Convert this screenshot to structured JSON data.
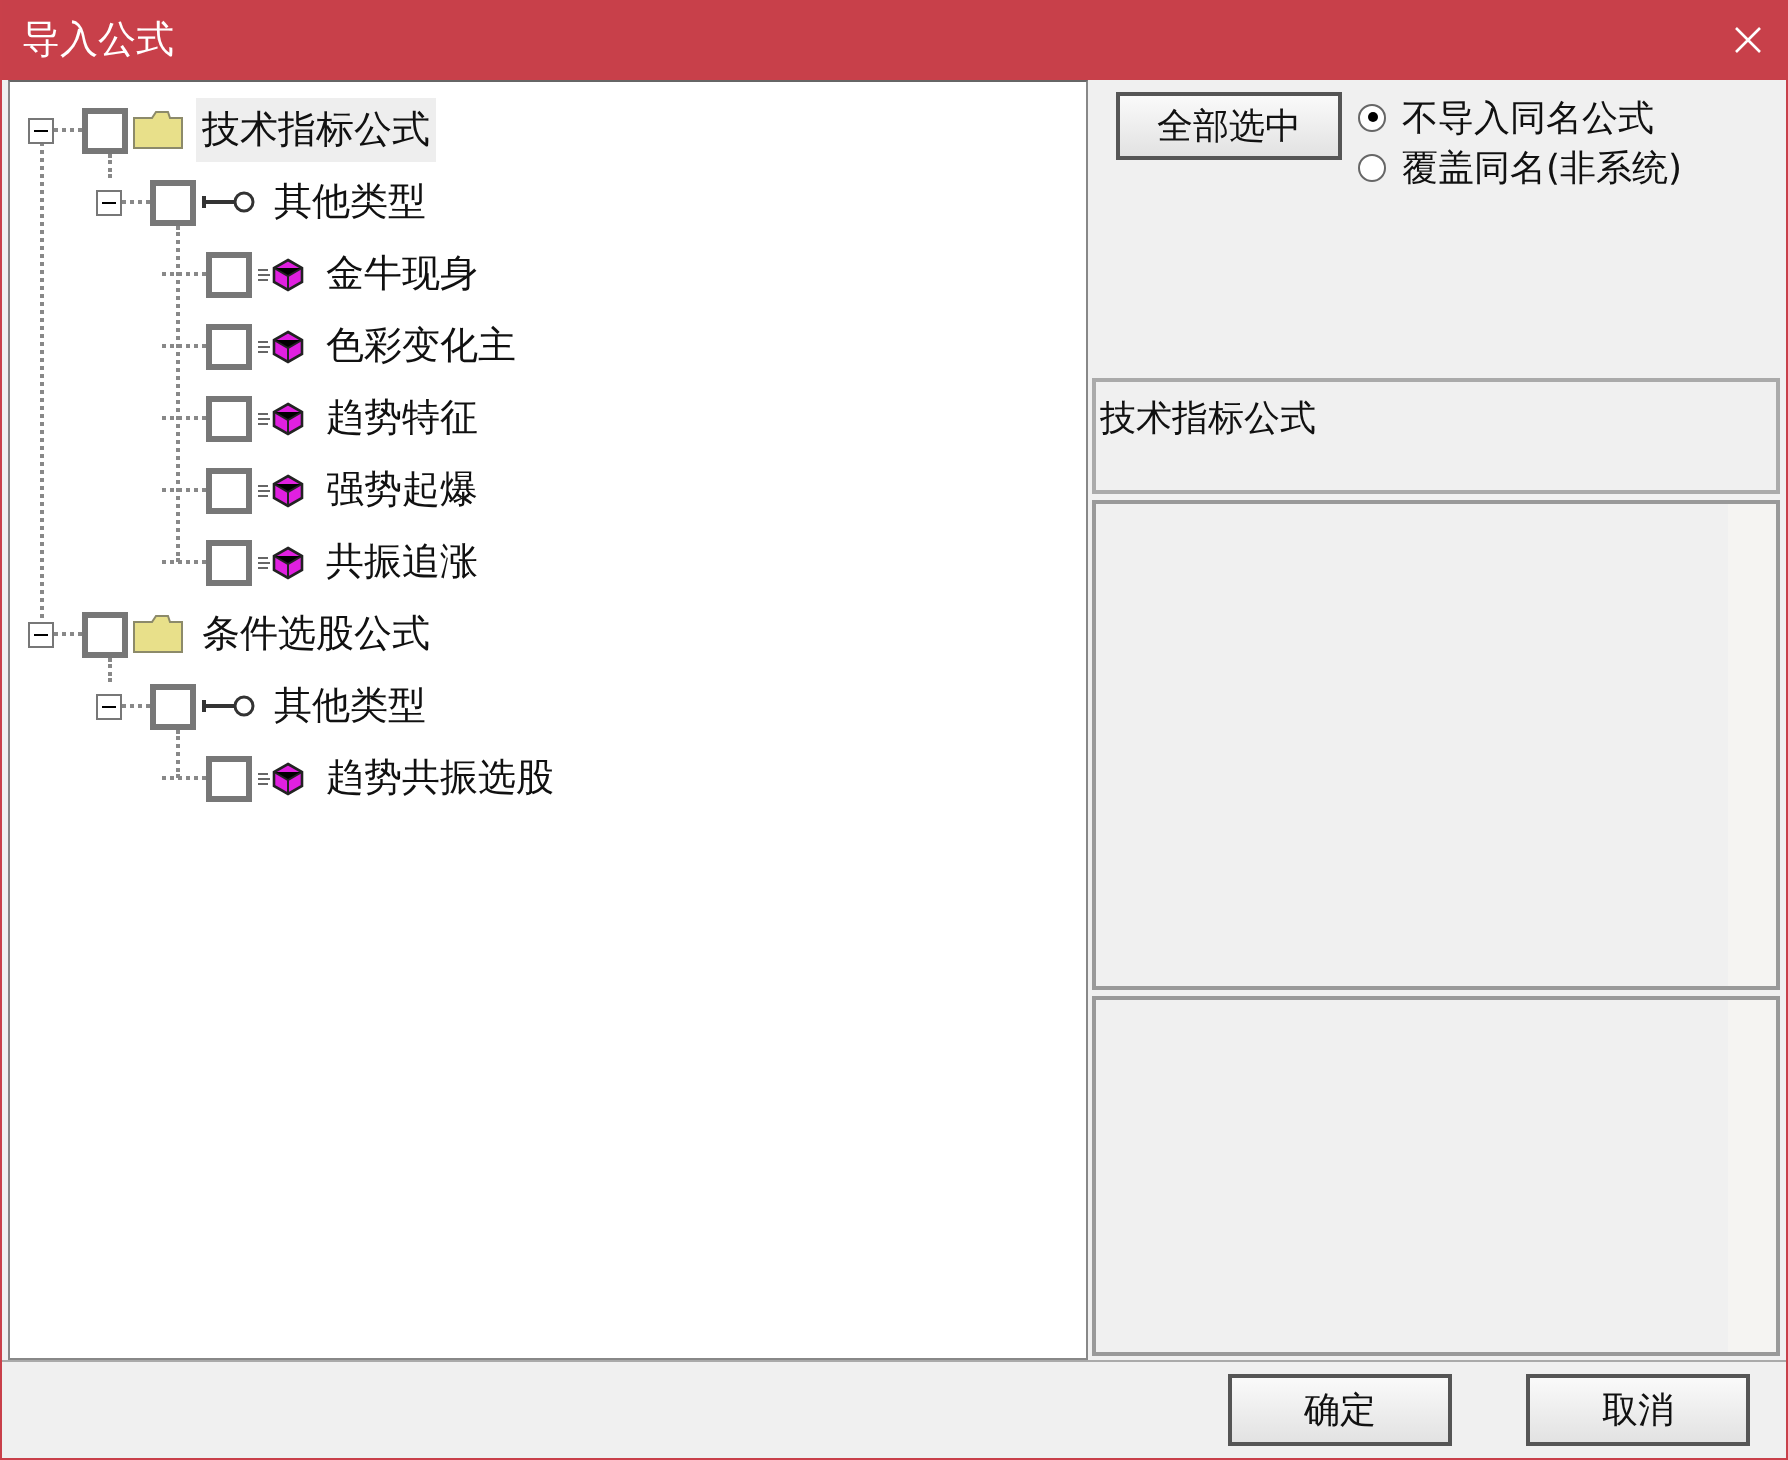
{
  "window": {
    "title": "导入公式"
  },
  "tree": [
    {
      "kind": "folder",
      "label": "技术指标公式",
      "checked": false,
      "selected": true,
      "expanded": true,
      "children": [
        {
          "kind": "group",
          "label": "其他类型",
          "checked": false,
          "selected": false,
          "expanded": true,
          "children": [
            {
              "kind": "formula",
              "label": "金牛现身",
              "checked": false,
              "selected": false
            },
            {
              "kind": "formula",
              "label": "色彩变化主",
              "checked": false,
              "selected": false
            },
            {
              "kind": "formula",
              "label": "趋势特征",
              "checked": false,
              "selected": false
            },
            {
              "kind": "formula",
              "label": "强势起爆",
              "checked": false,
              "selected": false
            },
            {
              "kind": "formula",
              "label": "共振追涨",
              "checked": false,
              "selected": false
            }
          ]
        }
      ]
    },
    {
      "kind": "folder",
      "label": "条件选股公式",
      "checked": false,
      "selected": false,
      "expanded": true,
      "children": [
        {
          "kind": "group",
          "label": "其他类型",
          "checked": false,
          "selected": false,
          "expanded": true,
          "children": [
            {
              "kind": "formula",
              "label": "趋势共振选股",
              "checked": false,
              "selected": false
            }
          ]
        }
      ]
    }
  ],
  "select_all_button": "全部选中",
  "options": [
    {
      "label": "不导入同名公式",
      "selected": true
    },
    {
      "label": "覆盖同名(非系统)",
      "selected": false
    }
  ],
  "category_field": "技术指标公式",
  "buttons": [
    "确定",
    "取消"
  ]
}
